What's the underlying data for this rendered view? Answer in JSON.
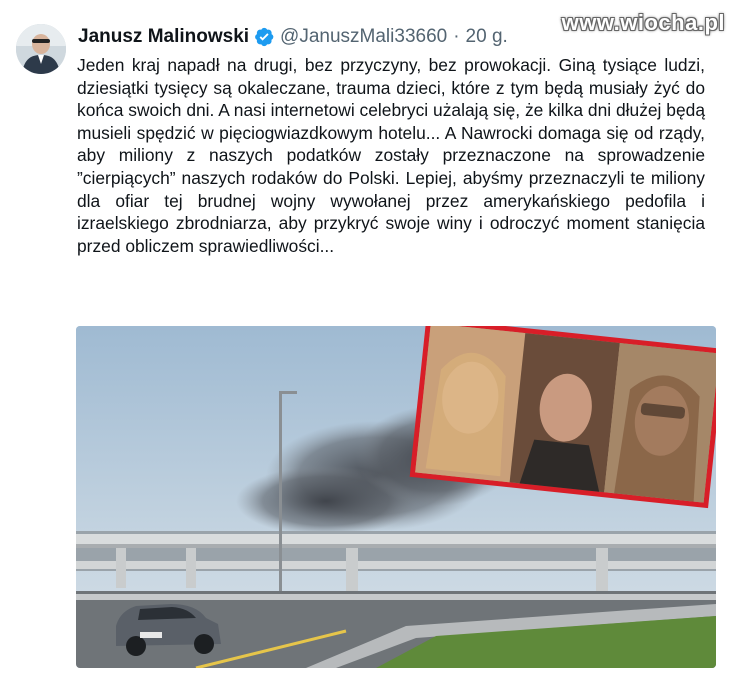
{
  "author": {
    "display_name": "Janusz Malinowski",
    "handle": "@JanuszMali33660",
    "separator": "·",
    "time": "20 g."
  },
  "watermark": "www.wiocha.pl",
  "tweet": {
    "text": "Jeden kraj napadł na drugi, bez przyczyny, bez prowokacji. Giną tysiące ludzi, dziesiątki tysięcy są okaleczane, trauma dzieci, które z tym będą musiały żyć do końca swoich dni. A nasi internetowi celebryci użalają się, że kilka dni dłużej będą musieli spędzić w pięciogwiazdkowym hotelu... A Nawrocki domaga się od rządy, aby miliony z naszych podatków zostały przeznaczone na sprowadzenie ”cierpiących” naszych rodaków do Polski. Lepiej, abyśmy przeznaczyli te miliony dla ofiar tej brudnej wojny wywołanej przez amerykańskiego pedofila i izraelskiego zbrodniarza, aby przykryć swoje winy i odroczyć moment stanięcia przed obliczem sprawiedliwości..."
  },
  "icons": {
    "verified": "verified-badge-icon",
    "avatar": "profile-avatar"
  },
  "colors": {
    "verified_blue": "#1d9bf0",
    "secondary_text": "#536471",
    "primary_text": "#0f1419",
    "inset_border": "#d81e28"
  }
}
